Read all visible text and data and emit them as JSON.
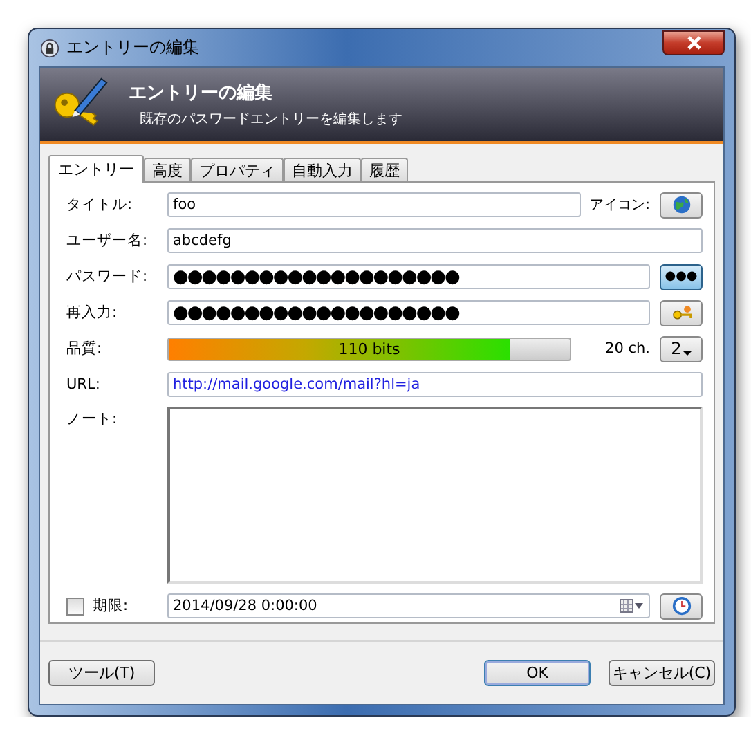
{
  "window": {
    "title": "エントリーの編集"
  },
  "banner": {
    "title": "エントリーの編集",
    "subtitle": "既存のパスワードエントリーを編集します"
  },
  "tabs": [
    {
      "label": "エントリー",
      "selected": true
    },
    {
      "label": "高度",
      "selected": false
    },
    {
      "label": "プロパティ",
      "selected": false
    },
    {
      "label": "自動入力",
      "selected": false
    },
    {
      "label": "履歴",
      "selected": false
    }
  ],
  "fields": {
    "title_label": "タイトル:",
    "title": "foo",
    "icon_label": "アイコン:",
    "username_label": "ユーザー名:",
    "username": "abcdefg",
    "password_label": "パスワード:",
    "password": "●●●●●●●●●●●●●●●●●●●●",
    "hide_button": {
      "label": "●●●",
      "pressed": true
    },
    "repeat_label": "再入力:",
    "repeat": "●●●●●●●●●●●●●●●●●●●●",
    "quality_label": "品質:",
    "quality": {
      "level": 0.85,
      "reading": "110 bits"
    },
    "length": "20 ch.",
    "generator_button": "2",
    "url_label": "URL:",
    "url": "http://mail.google.com/mail?hl=ja",
    "notes_label": "ノート:",
    "expires": {
      "checked": false,
      "label": "期限:",
      "value": "2014/09/28   0:00:00"
    }
  },
  "buttons": {
    "tools": "ツール(T)",
    "ok": "OK",
    "cancel": "キャンセル(C)"
  }
}
